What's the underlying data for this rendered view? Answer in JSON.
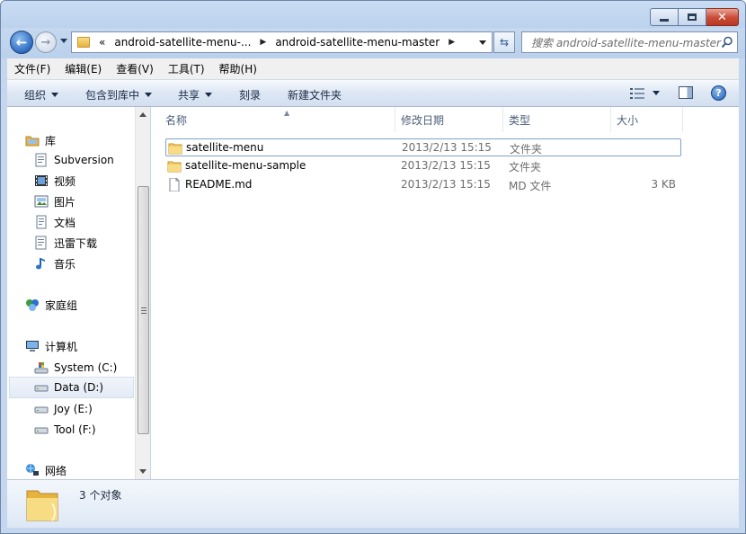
{
  "window": {
    "minimize_icon": "minimize-icon",
    "maximize_icon": "maximize-icon",
    "close_icon": "close-icon"
  },
  "address": {
    "overflow": "«",
    "segments": [
      "android-satellite-menu-...",
      "android-satellite-menu-master"
    ],
    "search_placeholder": "搜索 android-satellite-menu-master"
  },
  "menubar": {
    "items": [
      "文件(F)",
      "编辑(E)",
      "查看(V)",
      "工具(T)",
      "帮助(H)"
    ]
  },
  "toolbar": {
    "organize": "组织",
    "include_in_library": "包含到库中",
    "share": "共享",
    "burn": "刻录",
    "new_folder": "新建文件夹"
  },
  "navpane": {
    "library": "库",
    "library_items": [
      "Subversion",
      "视频",
      "图片",
      "文档",
      "迅雷下载",
      "音乐"
    ],
    "homegroup": "家庭组",
    "computer": "计算机",
    "drives": [
      "System (C:)",
      "Data (D:)",
      "Joy (E:)",
      "Tool (F:)"
    ],
    "network": "网络",
    "selected_drive": "Data (D:)"
  },
  "columns": {
    "name": "名称",
    "date": "修改日期",
    "type": "类型",
    "size": "大小"
  },
  "files": [
    {
      "name": "satellite-menu",
      "date": "2013/2/13 15:15",
      "type": "文件夹",
      "size": "",
      "icon": "folder-icon"
    },
    {
      "name": "satellite-menu-sample",
      "date": "2013/2/13 15:15",
      "type": "文件夹",
      "size": "",
      "icon": "folder-icon"
    },
    {
      "name": "README.md",
      "date": "2013/2/13 15:15",
      "type": "MD 文件",
      "size": "3 KB",
      "icon": "file-icon"
    }
  ],
  "status": {
    "count": "3 个对象"
  },
  "colors": {
    "chrome": "#c4d7ee",
    "accent": "#2d6bc1",
    "close": "#c94a35"
  }
}
